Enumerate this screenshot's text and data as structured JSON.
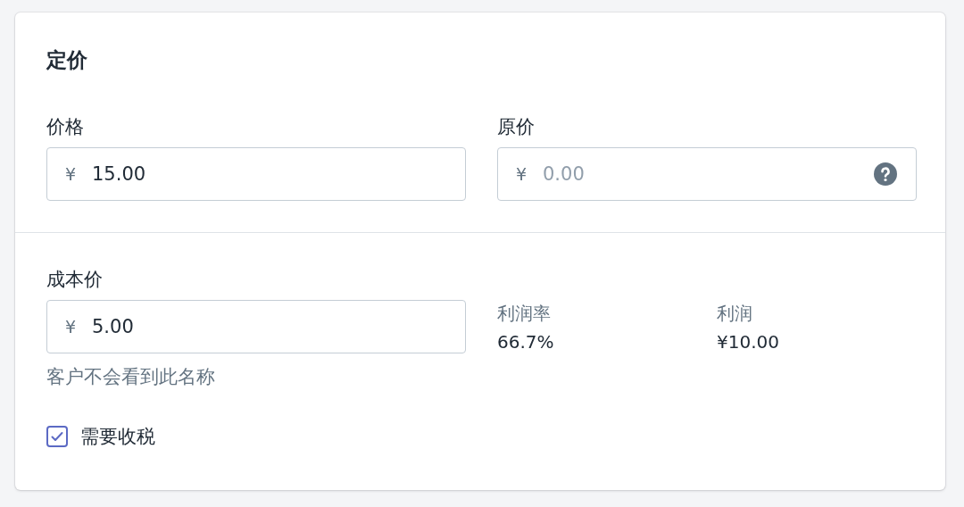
{
  "card": {
    "title": "定价",
    "price_fields": [
      {
        "label": "价格",
        "currency": "¥",
        "value": "15.00",
        "has_help": false
      },
      {
        "label": "原价",
        "currency": "¥",
        "placeholder": "0.00",
        "has_help": true
      }
    ],
    "cost": {
      "label": "成本价",
      "currency": "¥",
      "value": "5.00",
      "hint": "客户不会看到此名称"
    },
    "stats": [
      {
        "label": "利润率",
        "value": "66.7%"
      },
      {
        "label": "利润",
        "value": "¥10.00"
      }
    ],
    "tax": {
      "label": "需要收税",
      "checked": true
    }
  }
}
